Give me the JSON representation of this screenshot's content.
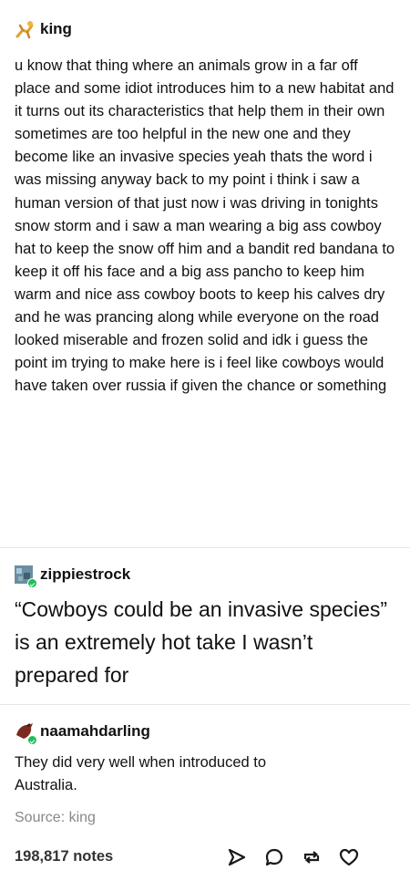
{
  "posts": [
    {
      "username": "king",
      "avatar_icon": "dancing-figure-icon",
      "text": "u know that thing where an animals grow in a far off place and some idiot introduces him to a new habitat and it turns out its characteristics that help them in their own sometimes are too helpful in the new one and they become like an invasive species yeah thats the word i was missing anyway back to my point i think i saw a human version of that just now i was driving in tonights snow storm and i saw a man wearing a big ass cowboy hat to keep the snow off him and a bandit red bandana to keep it off his face and a big ass pancho to keep him warm and nice ass cowboy boots to keep his calves dry and he was prancing along while everyone on the road looked miserable and frozen solid and idk i guess the point im trying to make here is i feel like cowboys would have taken over russia if given the chance or something"
    },
    {
      "username": "zippiestrock",
      "avatar_icon": "pixel-art-icon",
      "text": "“Cowboys could be an invasive species” is an extremely hot take I wasn’t prepared for"
    },
    {
      "username": "naamahdarling",
      "avatar_icon": "horse-head-icon",
      "text": "They did very well when introduced to Australia."
    }
  ],
  "source": "Source: king",
  "notes": "198,817 notes",
  "actions": [
    "share-icon",
    "reply-icon",
    "reblog-icon",
    "like-icon"
  ],
  "colors": {
    "verified_badge": "#1fbf5a",
    "divider": "#e6e6e6",
    "muted_text": "#888888"
  }
}
